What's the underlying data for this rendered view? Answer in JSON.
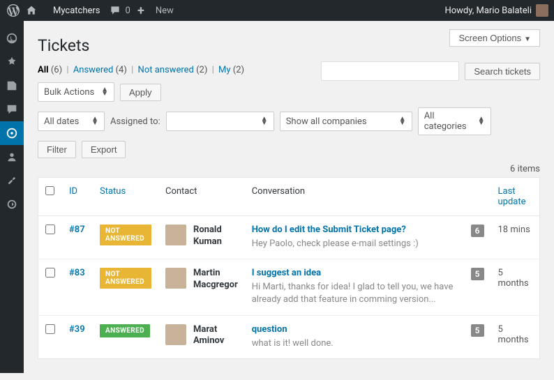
{
  "adminbar": {
    "site_name": "Mycatchers",
    "comments_count": "0",
    "new_label": "New",
    "howdy": "Howdy, Mario Balateli"
  },
  "page": {
    "title": "Tickets",
    "screen_options": "Screen Options"
  },
  "filters": {
    "all_label": "All",
    "all_count": "(6)",
    "answered_label": "Answered",
    "answered_count": "(4)",
    "not_answered_label": "Not answered",
    "not_answered_count": "(2)",
    "my_label": "My",
    "my_count": "(2)"
  },
  "search": {
    "button": "Search tickets"
  },
  "bulk": {
    "actions": "Bulk Actions",
    "apply": "Apply",
    "all_dates": "All dates",
    "assigned_to": "Assigned to:",
    "companies": "Show all companies",
    "categories": "All categories",
    "filter": "Filter",
    "export": "Export"
  },
  "pagination": {
    "items": "6 items"
  },
  "columns": {
    "id": "ID",
    "status": "Status",
    "contact": "Contact",
    "conversation": "Conversation",
    "last_update": "Last update"
  },
  "status_badges": {
    "not_answered": "NOT ANSWERED",
    "answered": "ANSWERED"
  },
  "rows": [
    {
      "id": "#87",
      "status": "not_answered",
      "contact": "Ronald Kuman",
      "title": "How do I edit the Submit Ticket page?",
      "snippet": "Hey Paolo, check please e-mail settings :)",
      "count": "6",
      "updated": "18 mins"
    },
    {
      "id": "#83",
      "status": "not_answered",
      "contact": "Martin Macgregor",
      "title": "I suggest an idea",
      "snippet": "Hi Marti, thanks for idea! I glad to tell you, we have already add that feature in comming version...",
      "count": "5",
      "updated": "5 months"
    },
    {
      "id": "#39",
      "status": "answered",
      "contact": "Marat Aminov",
      "title": "question",
      "snippet": "what is it!  well done.",
      "count": "5",
      "updated": "5 months"
    }
  ]
}
